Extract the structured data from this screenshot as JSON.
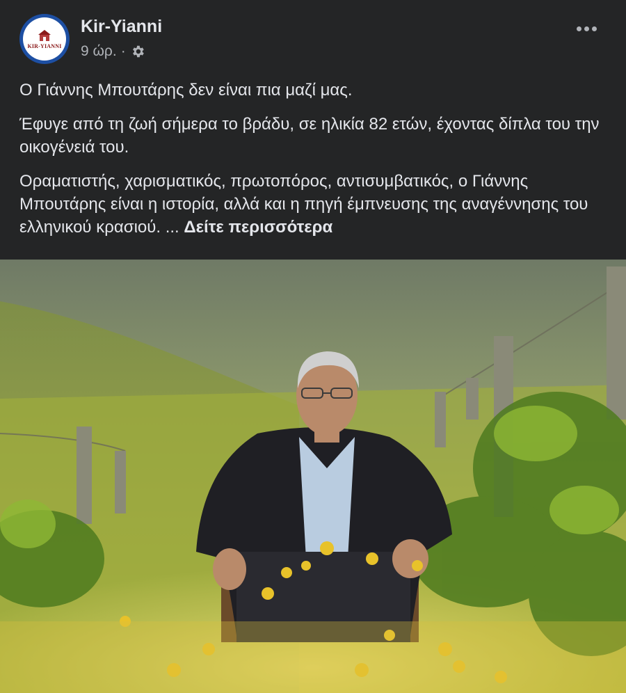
{
  "post": {
    "page_name": "Kir-Yianni",
    "logo_text": "KIR-YIANNI",
    "time": "9 ώρ.",
    "separator": "·",
    "audience_icon": "gear-icon",
    "more_icon": "more-icon",
    "paragraph_1": "Ο Γιάννης Μπουτάρης δεν είναι πια μαζί μας.",
    "paragraph_2": "Έφυγε από τη ζωή σήμερα το βράδυ, σε ηλικία 82 ετών, έχοντας δίπλα του την οικογένειά του.",
    "paragraph_3": "Οραματιστής, χαρισματικός, πρωτοπόρος, αντισυμβατικός, ο Γιάννης Μπουτάρης είναι η ιστορία, αλλά και η πηγή έμπνευσης της αναγέννησης του ελληνικού κρασιού. ...",
    "see_more": "Δείτε περισσότερα"
  },
  "colors": {
    "background": "#242526",
    "text": "#e4e6eb",
    "secondary_text": "#b0b3b8",
    "avatar_ring": "#1d4fa3",
    "logo_red": "#8b1a1a"
  }
}
